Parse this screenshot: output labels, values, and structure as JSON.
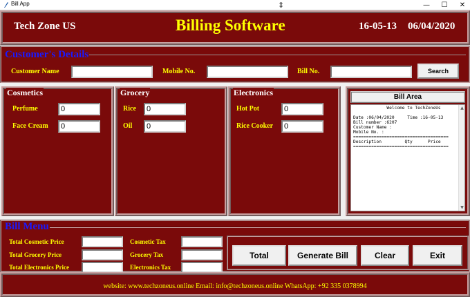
{
  "window": {
    "title": "Bill App",
    "icon": "feather-icon",
    "cursor_glyph": "⇕",
    "controls": {
      "minimize": "—",
      "maximize": "☐",
      "close": "✕"
    }
  },
  "header": {
    "shop_name": "Tech Zone US",
    "app_title": "Billing Software",
    "time": "16-05-13",
    "date": "06/04/2020"
  },
  "customer": {
    "legend": "Customer's Details",
    "name_label": "Customer Name",
    "name_value": "",
    "mobile_label": "Mobile No.",
    "mobile_value": "",
    "bill_label": "Bill No.",
    "bill_value": "",
    "search_label": "Search"
  },
  "cosmetics": {
    "legend": "Cosmetics",
    "items": [
      {
        "label": "Perfume",
        "value": "0"
      },
      {
        "label": "Face Cream",
        "value": "0"
      }
    ]
  },
  "grocery": {
    "legend": "Grocery",
    "items": [
      {
        "label": "Rice",
        "value": "0"
      },
      {
        "label": "Oil",
        "value": "0"
      }
    ]
  },
  "electronics": {
    "legend": "Electronics",
    "items": [
      {
        "label": "Hot Pot",
        "value": "0"
      },
      {
        "label": "Rice Cooker",
        "value": "0"
      }
    ]
  },
  "bill_area": {
    "title": "Bill Area",
    "text": "             Welcome to TechZoneUs\n\nDate :06/04/2020     Time :16-05-13\nBill number :6207\nCustomer Name :\nMobile No. :\n=====================================\nDescription         Qty      Price\n====================================="
  },
  "menu": {
    "legend": "Bill Menu",
    "total_cosmetic_label": "Total Cosmetic Price",
    "total_cosmetic_value": "",
    "total_grocery_label": "Total Grocery Price",
    "total_grocery_value": "",
    "total_electronics_label": "Total Electronics Price",
    "total_electronics_value": "",
    "cosmetic_tax_label": "Cosmetic Tax",
    "cosmetic_tax_value": "",
    "grocery_tax_label": "Grocery Tax",
    "grocery_tax_value": "",
    "electronics_tax_label": "Electronics Tax",
    "electronics_tax_value": "",
    "buttons": {
      "total": "Total",
      "generate": "Generate Bill",
      "clear": "Clear",
      "exit": "Exit"
    }
  },
  "footer": {
    "contact": "website: www.techzoneus.online Email: info@techzoneus.online WhatsApp: +92 335 0378994"
  },
  "colors": {
    "panel_bg": "#7a0a0a",
    "legend_blue": "#1a1aff",
    "label_yellow": "#ffff00",
    "title_yellow": "#ffff00"
  }
}
